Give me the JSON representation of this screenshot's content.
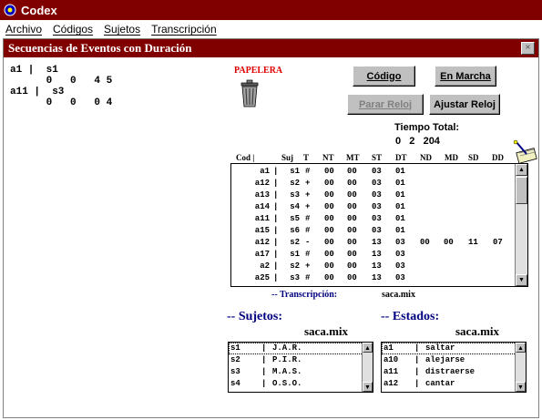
{
  "app": {
    "title": "Codex"
  },
  "menu": [
    "Archivo",
    "Códigos",
    "Sujetos",
    "Transcripción"
  ],
  "window": {
    "title": "Secuencias de Eventos con Duración",
    "close_glyph": "×"
  },
  "left_panel": {
    "lines": [
      "a1 |  s1",
      "      0   0   4 5",
      "a11 |  s3",
      "      0   0   0 4"
    ]
  },
  "trash": {
    "label": "PAPELERA"
  },
  "buttons": {
    "codigo": "Código",
    "en_marcha": "En Marcha",
    "parar_reloj": "Parar Reloj",
    "ajustar_reloj": "Ajustar Reloj"
  },
  "tiempo_total": {
    "label": "Tiempo Total:",
    "value": "0   2   204"
  },
  "grid": {
    "headers": [
      "Cod |",
      "Suj",
      "T",
      "NT",
      "MT",
      "ST",
      "DT",
      "ND",
      "MD",
      "SD",
      "DD"
    ],
    "rows": [
      [
        "a1",
        "s1",
        "#",
        "00",
        "00",
        "03",
        "01",
        "",
        "",
        "",
        ""
      ],
      [
        "a12",
        "s2",
        "+",
        "00",
        "00",
        "03",
        "01",
        "",
        "",
        "",
        ""
      ],
      [
        "a13",
        "s3",
        "+",
        "00",
        "00",
        "03",
        "01",
        "",
        "",
        "",
        ""
      ],
      [
        "a14",
        "s4",
        "+",
        "00",
        "00",
        "03",
        "01",
        "",
        "",
        "",
        ""
      ],
      [
        "a11",
        "s5",
        "#",
        "00",
        "00",
        "03",
        "01",
        "",
        "",
        "",
        ""
      ],
      [
        "a15",
        "s6",
        "#",
        "00",
        "00",
        "03",
        "01",
        "",
        "",
        "",
        ""
      ],
      [
        "a12",
        "s2",
        "-",
        "00",
        "00",
        "13",
        "03",
        "00",
        "00",
        "11",
        "07"
      ],
      [
        "a17",
        "s1",
        "#",
        "00",
        "00",
        "13",
        "03",
        "",
        "",
        "",
        ""
      ],
      [
        "a2",
        "s2",
        "+",
        "00",
        "00",
        "13",
        "03",
        "",
        "",
        "",
        ""
      ],
      [
        "a25",
        "s3",
        "#",
        "00",
        "00",
        "13",
        "03",
        "",
        "",
        "",
        ""
      ]
    ]
  },
  "transcripcion": {
    "label": "-- Transcripción:",
    "file": "saca.mix"
  },
  "sujetos": {
    "label": "-- Sujetos:",
    "file": "saca.mix",
    "items": [
      [
        "s1",
        "J.A.R."
      ],
      [
        "s2",
        "P.I.R."
      ],
      [
        "s3",
        "M.A.S."
      ],
      [
        "s4",
        "O.S.O."
      ]
    ]
  },
  "estados": {
    "label": "-- Estados:",
    "file": "saca.mix",
    "items": [
      [
        "a1",
        "saltar"
      ],
      [
        "a10",
        "alejarse"
      ],
      [
        "a11",
        "distraerse"
      ],
      [
        "a12",
        "cantar"
      ]
    ]
  }
}
